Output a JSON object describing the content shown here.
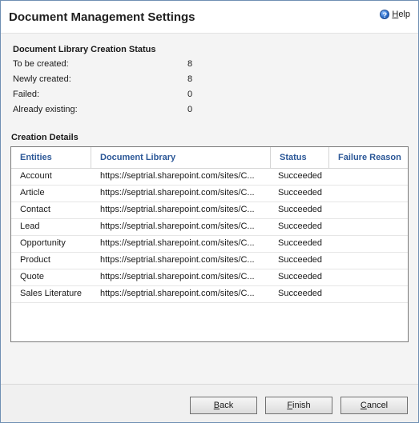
{
  "dialog": {
    "title": "Document Management Settings",
    "help": {
      "pre": "",
      "mnemonic": "H",
      "rest": "elp"
    }
  },
  "status": {
    "heading": "Document Library Creation Status",
    "rows": [
      {
        "label": "To be created:",
        "value": "8"
      },
      {
        "label": "Newly created:",
        "value": "8"
      },
      {
        "label": "Failed:",
        "value": "0"
      },
      {
        "label": "Already existing:",
        "value": "0"
      }
    ]
  },
  "details": {
    "heading": "Creation Details",
    "columns": [
      "Entities",
      "Document Library",
      "Status",
      "Failure Reason"
    ],
    "rows": [
      {
        "entity": "Account",
        "library": "https://septrial.sharepoint.com/sites/C...",
        "status": "Succeeded",
        "reason": ""
      },
      {
        "entity": "Article",
        "library": "https://septrial.sharepoint.com/sites/C...",
        "status": "Succeeded",
        "reason": ""
      },
      {
        "entity": "Contact",
        "library": "https://septrial.sharepoint.com/sites/C...",
        "status": "Succeeded",
        "reason": ""
      },
      {
        "entity": "Lead",
        "library": "https://septrial.sharepoint.com/sites/C...",
        "status": "Succeeded",
        "reason": ""
      },
      {
        "entity": "Opportunity",
        "library": "https://septrial.sharepoint.com/sites/C...",
        "status": "Succeeded",
        "reason": ""
      },
      {
        "entity": "Product",
        "library": "https://septrial.sharepoint.com/sites/C...",
        "status": "Succeeded",
        "reason": ""
      },
      {
        "entity": "Quote",
        "library": "https://septrial.sharepoint.com/sites/C...",
        "status": "Succeeded",
        "reason": ""
      },
      {
        "entity": "Sales Literature",
        "library": "https://septrial.sharepoint.com/sites/C...",
        "status": "Succeeded",
        "reason": ""
      }
    ]
  },
  "buttons": {
    "back": {
      "mnemonic": "B",
      "rest": "ack"
    },
    "finish": {
      "mnemonic": "F",
      "rest": "inish"
    },
    "cancel": {
      "mnemonic": "C",
      "rest": "ancel"
    }
  },
  "icons": {
    "help": "help-circle-icon"
  },
  "colors": {
    "accent": "#2b5797",
    "border": "#6f8fb3"
  }
}
